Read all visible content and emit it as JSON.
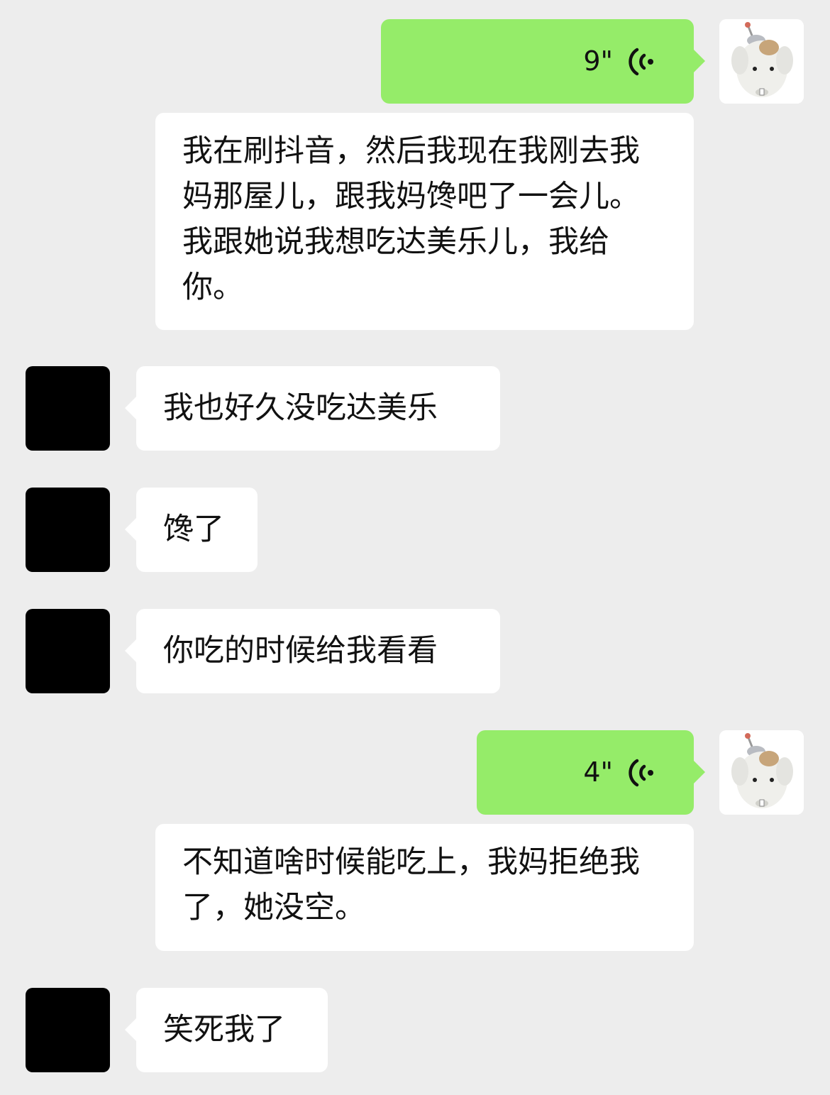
{
  "messages": [
    {
      "id": "m1",
      "side": "right",
      "type": "voice",
      "duration": "9\""
    },
    {
      "id": "m1t",
      "side": "right",
      "type": "transcript",
      "text": "我在刷抖音，然后我现在我刚去我妈那屋儿，跟我妈馋吧了一会儿。我跟她说我想吃达美乐儿，我给你。"
    },
    {
      "id": "m2",
      "side": "left",
      "type": "text",
      "text": "我也好久没吃达美乐"
    },
    {
      "id": "m3",
      "side": "left",
      "type": "text",
      "text": "馋了"
    },
    {
      "id": "m4",
      "side": "left",
      "type": "text",
      "text": "你吃的时候给我看看"
    },
    {
      "id": "m5",
      "side": "right",
      "type": "voice",
      "duration": "4\""
    },
    {
      "id": "m5t",
      "side": "right",
      "type": "transcript",
      "text": "不知道啥时候能吃上，我妈拒绝我了，她没空。"
    },
    {
      "id": "m6",
      "side": "left",
      "type": "text",
      "text": "笑死我了"
    }
  ],
  "icons": {
    "voice": "voice-wave-icon",
    "my_avatar": "white-dog-plush-avatar",
    "other_avatar": "redacted-black-avatar"
  },
  "colors": {
    "background": "#ededed",
    "my_bubble": "#95ec69",
    "other_bubble": "#ffffff",
    "redacted_avatar": "#000000"
  }
}
